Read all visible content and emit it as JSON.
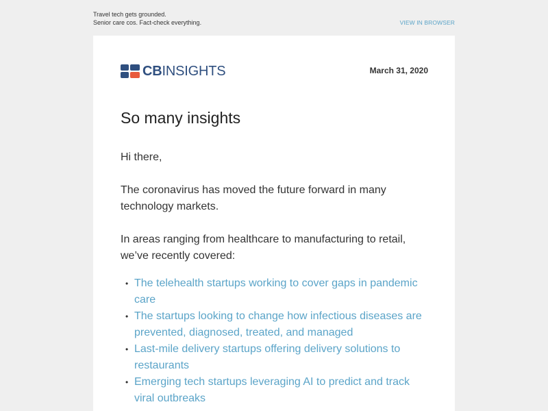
{
  "preheader": {
    "line1": "Travel tech gets grounded.",
    "line2": "Senior care cos. Fact-check everything.",
    "view_in_browser": "VIEW IN BROWSER"
  },
  "header": {
    "logo_cb": "CB",
    "logo_insights": "INSIGHTS",
    "date": "March 31, 2020"
  },
  "main": {
    "title": "So many insights",
    "greeting": "Hi there,",
    "paragraph1": "The coronavirus has moved the future forward in many technology markets.",
    "paragraph2": "In areas ranging from healthcare to manufacturing to retail, we’ve recently covered:",
    "links": [
      "The telehealth startups working to cover gaps in pandemic care",
      "The startups looking to change how infectious diseases are prevented, diagnosed, treated, and managed",
      "Last-mile delivery startups offering delivery solutions to restaurants",
      "Emerging tech startups leveraging AI to predict and track viral outbreaks"
    ]
  },
  "colors": {
    "background": "#efefef",
    "card": "#ffffff",
    "link": "#5ba4c8",
    "logo_navy": "#2f4f7f",
    "logo_orange": "#e85a3c",
    "text": "#333333"
  },
  "icons": {
    "logo": "cb-insights-logo-icon",
    "bullet": "bullet-icon"
  }
}
